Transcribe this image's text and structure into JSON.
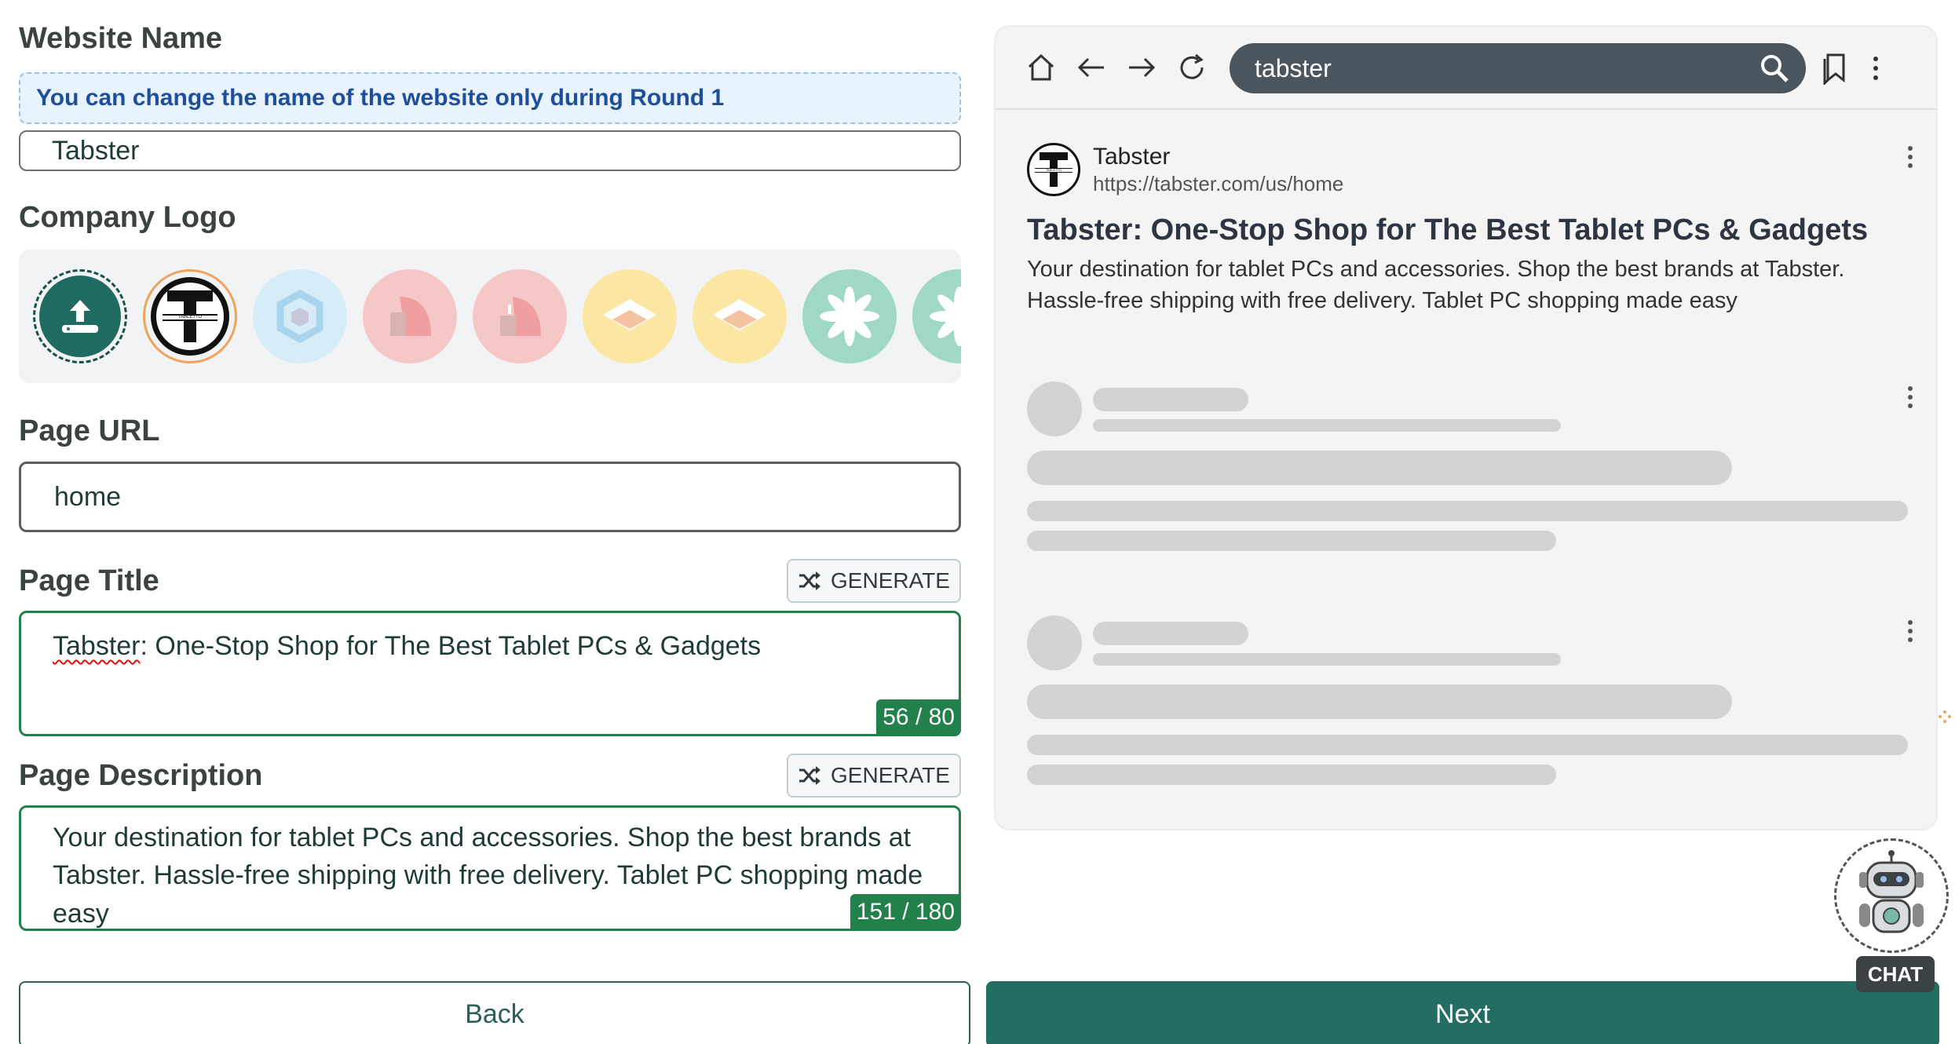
{
  "form": {
    "website_name": {
      "label": "Website Name",
      "notice": "You can change the name of the website only during Round 1",
      "value": "Tabster"
    },
    "company_logo": {
      "label": "Company Logo",
      "upload_icon": "upload-icon",
      "logos": [
        "tabletto",
        "hexagon",
        "leaf-red",
        "leaf-red-2",
        "diamond-yellow",
        "diamond-yellow-2",
        "flower-green",
        "flower-green-2"
      ]
    },
    "page_url": {
      "label": "Page URL",
      "value": "home"
    },
    "page_title": {
      "label": "Page Title",
      "generate_label": "GENERATE",
      "value_first_word": "Tabster",
      "value_rest": ": One-Stop Shop for The Best Tablet PCs & Gadgets",
      "counter": "56 / 80"
    },
    "page_description": {
      "label": "Page Description",
      "generate_label": "GENERATE",
      "value": "Your destination for tablet PCs and accessories. Shop the best brands at Tabster. Hassle-free shipping with free delivery. Tablet PC shopping made easy",
      "counter": "151 / 180"
    }
  },
  "buttons": {
    "back": "Back",
    "next": "Next"
  },
  "preview": {
    "search_query": "tabster",
    "result": {
      "site_name": "Tabster",
      "site_url": "https://tabster.com/us/home",
      "logo_text": "TABLETTO",
      "title": "Tabster: One-Stop Shop for The Best Tablet PCs & Gadgets",
      "description": "Your destination for tablet PCs and accessories. Shop the best brands at Tabster. Hassle-free shipping with free delivery. Tablet PC shopping made easy"
    }
  },
  "chat": {
    "label": "CHAT"
  },
  "colors": {
    "accent": "#236d63",
    "valid_border": "#22804a",
    "notice_bg": "#e8f3fd",
    "notice_text": "#1f4f9a",
    "url_bar": "#4a555d"
  }
}
